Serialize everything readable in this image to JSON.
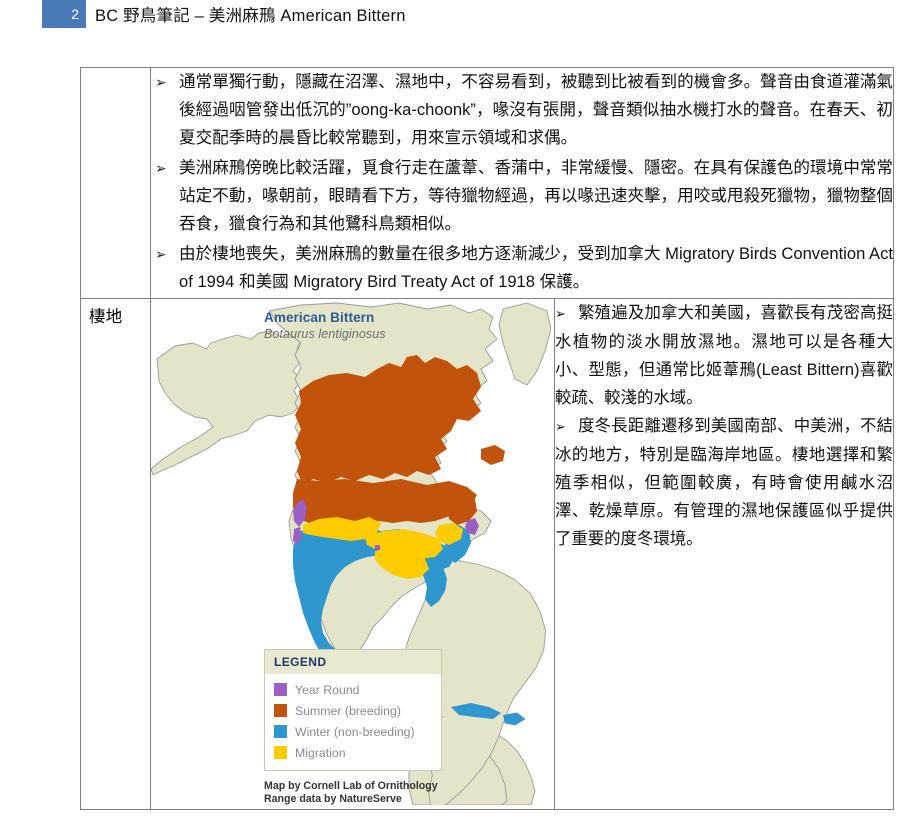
{
  "header": {
    "page_number": "2",
    "title": "BC 野鳥筆記 – 美洲麻鳽 American Bittern"
  },
  "notes": {
    "bullets": [
      "通常單獨行動，隱藏在沼澤、濕地中，不容易看到，被聽到比被看到的機會多。聲音由食道灌滿氣後經過咽管發出低沉的”oong-ka-choonk”，喙沒有張開，聲音類似抽水機打水的聲音。在春天、初夏交配季時的晨昏比較常聽到，用來宣示領域和求偶。",
      "美洲麻鳽傍晚比較活躍，覓食行走在蘆葦、香蒲中，非常緩慢、隱密。在具有保護色的環境中常常站定不動，喙朝前，眼睛看下方，等待獵物經過，再以喙迅速夾擊，用咬或甩殺死獵物，獵物整個吞食，獵食行為和其他鷺科鳥類相似。",
      "由於棲地喪失，美洲麻鳽的數量在很多地方逐漸減少，受到加拿大 Migratory Birds Convention Act of 1994 和美國 Migratory Bird Treaty Act of 1918 保護。"
    ],
    "bullet_marker": "➢"
  },
  "habitat_row": {
    "label": "棲地",
    "map": {
      "title": "American Bittern",
      "subtitle": "Botaurus lentiginosus",
      "legend": {
        "heading": "LEGEND",
        "items": [
          {
            "label": "Year Round",
            "color": "#9C5FC4"
          },
          {
            "label": "Summer (breeding)",
            "color": "#C1540A"
          },
          {
            "label": "Winter (non-breeding)",
            "color": "#2D97CE"
          },
          {
            "label": "Migration",
            "color": "#FFCC00"
          }
        ]
      },
      "credit_line_1": "Map by Cornell Lab of Ornithology",
      "credit_line_2": "Range data by NatureServe",
      "colors": {
        "land": "#E4E4C9",
        "ocean": "#FFFFFF",
        "border": "#9A9A9A"
      }
    },
    "paragraphs": [
      {
        "marker": "➢",
        "text": "繁殖遍及加拿大和美國，喜歡長有茂密高挺水植物的淡水開放濕地。濕地可以是各種大小、型態，但通常比姬葦鳽(Least Bittern)喜歡較疏、較淺的水域。"
      },
      {
        "marker": "➢",
        "text": "度冬長距離遷移到美國南部、中美洲，不結冰的地方，特別是臨海岸地區。棲地選擇和繁殖季相似，但範圍較廣，有時會使用鹹水沼澤、乾燥草原。有管理的濕地保護區似乎提供了重要的度冬環境。"
      }
    ]
  }
}
